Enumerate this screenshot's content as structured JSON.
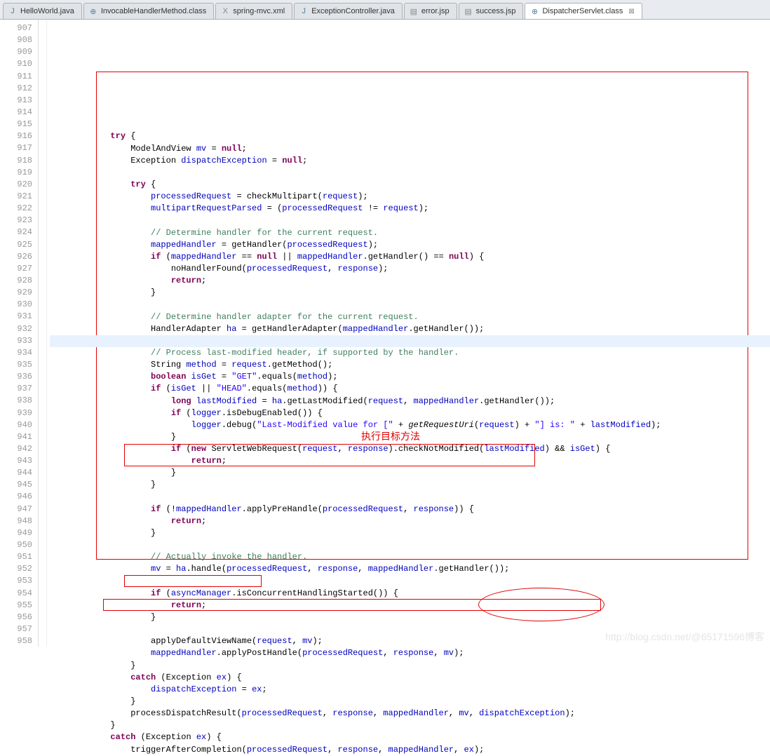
{
  "tabs": [
    {
      "label": "HelloWorld.java",
      "icon": "J",
      "iconClass": "icon-java",
      "active": false,
      "closable": false
    },
    {
      "label": "InvocableHandlerMethod.class",
      "icon": "⊕",
      "iconClass": "icon-class",
      "active": false,
      "closable": false
    },
    {
      "label": "spring-mvc.xml",
      "icon": "X",
      "iconClass": "icon-xml",
      "active": false,
      "closable": false
    },
    {
      "label": "ExceptionController.java",
      "icon": "J",
      "iconClass": "icon-java",
      "active": false,
      "closable": false
    },
    {
      "label": "error.jsp",
      "icon": "▤",
      "iconClass": "icon-jsp",
      "active": false,
      "closable": false
    },
    {
      "label": "success.jsp",
      "icon": "▤",
      "iconClass": "icon-jsp",
      "active": false,
      "closable": false
    },
    {
      "label": "DispatcherServlet.class",
      "icon": "⊕",
      "iconClass": "icon-class",
      "active": true,
      "closable": true
    }
  ],
  "lineStart": 907,
  "lineCount": 52,
  "highlightedLine": 924,
  "annotation": "执行目标方法",
  "watermark": "http://blog.csdn.net/@65171596博客",
  "code": {
    "l907": [
      [
        "kw",
        "try"
      ],
      [
        "",
        " {"
      ]
    ],
    "l908": [
      [
        "",
        "    ModelAndView "
      ],
      [
        "fld",
        "mv"
      ],
      [
        "",
        " = "
      ],
      [
        "kw",
        "null"
      ],
      [
        "",
        ";"
      ]
    ],
    "l909": [
      [
        "",
        "    Exception "
      ],
      [
        "fld",
        "dispatchException"
      ],
      [
        "",
        " = "
      ],
      [
        "kw",
        "null"
      ],
      [
        "",
        ";"
      ]
    ],
    "l910": [
      [
        "",
        ""
      ]
    ],
    "l911": [
      [
        "",
        "    "
      ],
      [
        "kw",
        "try"
      ],
      [
        "",
        " {"
      ]
    ],
    "l912": [
      [
        "",
        "        "
      ],
      [
        "fld",
        "processedRequest"
      ],
      [
        "",
        " = checkMultipart("
      ],
      [
        "fld",
        "request"
      ],
      [
        "",
        ");"
      ]
    ],
    "l913": [
      [
        "",
        "        "
      ],
      [
        "fld",
        "multipartRequestParsed"
      ],
      [
        "",
        " = ("
      ],
      [
        "fld",
        "processedRequest"
      ],
      [
        "",
        " != "
      ],
      [
        "fld",
        "request"
      ],
      [
        "",
        ");"
      ]
    ],
    "l914": [
      [
        "",
        ""
      ]
    ],
    "l915": [
      [
        "",
        "        "
      ],
      [
        "cmt",
        "// Determine handler for the current request."
      ]
    ],
    "l916": [
      [
        "",
        "        "
      ],
      [
        "fld",
        "mappedHandler"
      ],
      [
        "",
        " = getHandler("
      ],
      [
        "fld",
        "processedRequest"
      ],
      [
        "",
        ");"
      ]
    ],
    "l917": [
      [
        "",
        "        "
      ],
      [
        "kw",
        "if"
      ],
      [
        "",
        " ("
      ],
      [
        "fld",
        "mappedHandler"
      ],
      [
        "",
        " == "
      ],
      [
        "kw",
        "null"
      ],
      [
        "",
        " || "
      ],
      [
        "fld",
        "mappedHandler"
      ],
      [
        "",
        ".getHandler() == "
      ],
      [
        "kw",
        "null"
      ],
      [
        "",
        ") {"
      ]
    ],
    "l918": [
      [
        "",
        "            noHandlerFound("
      ],
      [
        "fld",
        "processedRequest"
      ],
      [
        "",
        ", "
      ],
      [
        "fld",
        "response"
      ],
      [
        "",
        ");"
      ]
    ],
    "l919": [
      [
        "",
        "            "
      ],
      [
        "kw",
        "return"
      ],
      [
        "",
        ";"
      ]
    ],
    "l920": [
      [
        "",
        "        }"
      ]
    ],
    "l921": [
      [
        "",
        ""
      ]
    ],
    "l922": [
      [
        "",
        "        "
      ],
      [
        "cmt",
        "// Determine handler adapter for the current request."
      ]
    ],
    "l923": [
      [
        "",
        "        HandlerAdapter "
      ],
      [
        "fld",
        "ha"
      ],
      [
        "",
        " = getHandlerAdapter("
      ],
      [
        "fld",
        "mappedHandler"
      ],
      [
        "",
        ".getHandler());"
      ]
    ],
    "l924": [
      [
        "",
        ""
      ]
    ],
    "l925": [
      [
        "",
        "        "
      ],
      [
        "cmt",
        "// Process last-modified header, if supported by the handler."
      ]
    ],
    "l926": [
      [
        "",
        "        String "
      ],
      [
        "fld",
        "method"
      ],
      [
        "",
        " = "
      ],
      [
        "fld",
        "request"
      ],
      [
        "",
        ".getMethod();"
      ]
    ],
    "l927": [
      [
        "",
        "        "
      ],
      [
        "kw",
        "boolean"
      ],
      [
        "",
        " "
      ],
      [
        "fld",
        "isGet"
      ],
      [
        "",
        " = "
      ],
      [
        "str",
        "\"GET\""
      ],
      [
        "",
        ".equals("
      ],
      [
        "fld",
        "method"
      ],
      [
        "",
        ");"
      ]
    ],
    "l928": [
      [
        "",
        "        "
      ],
      [
        "kw",
        "if"
      ],
      [
        "",
        " ("
      ],
      [
        "fld",
        "isGet"
      ],
      [
        "",
        " || "
      ],
      [
        "str",
        "\"HEAD\""
      ],
      [
        "",
        ".equals("
      ],
      [
        "fld",
        "method"
      ],
      [
        "",
        ")) {"
      ]
    ],
    "l929": [
      [
        "",
        "            "
      ],
      [
        "kw",
        "long"
      ],
      [
        "",
        " "
      ],
      [
        "fld",
        "lastModified"
      ],
      [
        "",
        " = "
      ],
      [
        "fld",
        "ha"
      ],
      [
        "",
        ".getLastModified("
      ],
      [
        "fld",
        "request"
      ],
      [
        "",
        ", "
      ],
      [
        "fld",
        "mappedHandler"
      ],
      [
        "",
        ".getHandler());"
      ]
    ],
    "l930": [
      [
        "",
        "            "
      ],
      [
        "kw",
        "if"
      ],
      [
        "",
        " ("
      ],
      [
        "fld",
        "logger"
      ],
      [
        "",
        ".isDebugEnabled()) {"
      ]
    ],
    "l931": [
      [
        "",
        "                "
      ],
      [
        "fld",
        "logger"
      ],
      [
        "",
        ".debug("
      ],
      [
        "str",
        "\"Last-Modified value for [\""
      ],
      [
        "",
        " + "
      ],
      [
        "itl",
        "getRequestUri"
      ],
      [
        "",
        "("
      ],
      [
        "fld",
        "request"
      ],
      [
        "",
        ") + "
      ],
      [
        "str",
        "\"] is: \""
      ],
      [
        "",
        " + "
      ],
      [
        "fld",
        "lastModified"
      ],
      [
        "",
        ");"
      ]
    ],
    "l932": [
      [
        "",
        "            }"
      ]
    ],
    "l933": [
      [
        "",
        "            "
      ],
      [
        "kw",
        "if"
      ],
      [
        "",
        " ("
      ],
      [
        "kw",
        "new"
      ],
      [
        "",
        " ServletWebRequest("
      ],
      [
        "fld",
        "request"
      ],
      [
        "",
        ", "
      ],
      [
        "fld",
        "response"
      ],
      [
        "",
        ").checkNotModified("
      ],
      [
        "fld",
        "lastModified"
      ],
      [
        "",
        ") && "
      ],
      [
        "fld",
        "isGet"
      ],
      [
        "",
        ") {"
      ]
    ],
    "l934": [
      [
        "",
        "                "
      ],
      [
        "kw",
        "return"
      ],
      [
        "",
        ";"
      ]
    ],
    "l935": [
      [
        "",
        "            }"
      ]
    ],
    "l936": [
      [
        "",
        "        }"
      ]
    ],
    "l937": [
      [
        "",
        ""
      ]
    ],
    "l938": [
      [
        "",
        "        "
      ],
      [
        "kw",
        "if"
      ],
      [
        "",
        " (!"
      ],
      [
        "fld",
        "mappedHandler"
      ],
      [
        "",
        ".applyPreHandle("
      ],
      [
        "fld",
        "processedRequest"
      ],
      [
        "",
        ", "
      ],
      [
        "fld",
        "response"
      ],
      [
        "",
        ")) {"
      ]
    ],
    "l939": [
      [
        "",
        "            "
      ],
      [
        "kw",
        "return"
      ],
      [
        "",
        ";"
      ]
    ],
    "l940": [
      [
        "",
        "        }"
      ]
    ],
    "l941": [
      [
        "",
        ""
      ]
    ],
    "l942": [
      [
        "",
        "        "
      ],
      [
        "cmt",
        "// Actually invoke the handler."
      ]
    ],
    "l943": [
      [
        "",
        "        "
      ],
      [
        "fld",
        "mv"
      ],
      [
        "",
        " = "
      ],
      [
        "fld",
        "ha"
      ],
      [
        "",
        ".handle("
      ],
      [
        "fld",
        "processedRequest"
      ],
      [
        "",
        ", "
      ],
      [
        "fld",
        "response"
      ],
      [
        "",
        ", "
      ],
      [
        "fld",
        "mappedHandler"
      ],
      [
        "",
        ".getHandler());"
      ]
    ],
    "l944": [
      [
        "",
        ""
      ]
    ],
    "l945": [
      [
        "",
        "        "
      ],
      [
        "kw",
        "if"
      ],
      [
        "",
        " ("
      ],
      [
        "fld",
        "asyncManager"
      ],
      [
        "",
        ".isConcurrentHandlingStarted()) {"
      ]
    ],
    "l946": [
      [
        "",
        "            "
      ],
      [
        "kw",
        "return"
      ],
      [
        "",
        ";"
      ]
    ],
    "l947": [
      [
        "",
        "        }"
      ]
    ],
    "l948": [
      [
        "",
        ""
      ]
    ],
    "l949": [
      [
        "",
        "        applyDefaultViewName("
      ],
      [
        "fld",
        "request"
      ],
      [
        "",
        ", "
      ],
      [
        "fld",
        "mv"
      ],
      [
        "",
        ");"
      ]
    ],
    "l950": [
      [
        "",
        "        "
      ],
      [
        "fld",
        "mappedHandler"
      ],
      [
        "",
        ".applyPostHandle("
      ],
      [
        "fld",
        "processedRequest"
      ],
      [
        "",
        ", "
      ],
      [
        "fld",
        "response"
      ],
      [
        "",
        ", "
      ],
      [
        "fld",
        "mv"
      ],
      [
        "",
        ");"
      ]
    ],
    "l951": [
      [
        "",
        "    }"
      ]
    ],
    "l952": [
      [
        "",
        "    "
      ],
      [
        "kw",
        "catch"
      ],
      [
        "",
        " (Exception "
      ],
      [
        "fld",
        "ex"
      ],
      [
        "",
        ") {"
      ]
    ],
    "l953": [
      [
        "",
        "        "
      ],
      [
        "fld",
        "dispatchException"
      ],
      [
        "",
        " = "
      ],
      [
        "fld",
        "ex"
      ],
      [
        "",
        ";"
      ]
    ],
    "l954": [
      [
        "",
        "    }"
      ]
    ],
    "l955": [
      [
        "",
        "    processDispatchResult("
      ],
      [
        "fld",
        "processedRequest"
      ],
      [
        "",
        ", "
      ],
      [
        "fld",
        "response"
      ],
      [
        "",
        ", "
      ],
      [
        "fld",
        "mappedHandler"
      ],
      [
        "",
        ", "
      ],
      [
        "fld",
        "mv"
      ],
      [
        "",
        ", "
      ],
      [
        "fld",
        "dispatchException"
      ],
      [
        "",
        ");"
      ]
    ],
    "l956": [
      [
        "",
        "}"
      ]
    ],
    "l957": [
      [
        "kw",
        "catch"
      ],
      [
        "",
        " (Exception "
      ],
      [
        "fld",
        "ex"
      ],
      [
        "",
        ") {"
      ]
    ],
    "l958": [
      [
        "",
        "    triggerAfterCompletion("
      ],
      [
        "fld",
        "processedRequest"
      ],
      [
        "",
        ", "
      ],
      [
        "fld",
        "response"
      ],
      [
        "",
        ", "
      ],
      [
        "fld",
        "mappedHandler"
      ],
      [
        "",
        ", "
      ],
      [
        "fld",
        "ex"
      ],
      [
        "",
        ");"
      ]
    ]
  }
}
